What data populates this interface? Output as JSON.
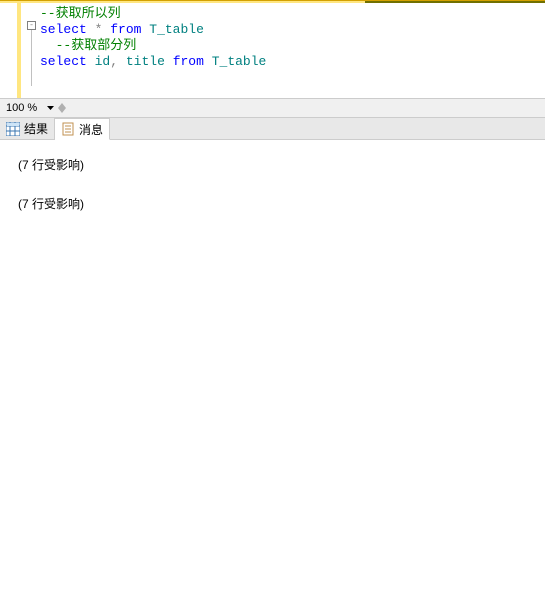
{
  "code": {
    "line1_comment": "--获取所以列",
    "line2": {
      "select": "select",
      "star": "*",
      "from": "from",
      "table": "T_table"
    },
    "line3_comment": "--获取部分列",
    "line4": {
      "select": "select",
      "col1": "id",
      "comma": ",",
      "col2": "title",
      "from": "from",
      "table": "T_table"
    }
  },
  "fold_marker": "-",
  "zoom": {
    "value": "100 %"
  },
  "tabs": {
    "results": "结果",
    "messages": "消息"
  },
  "output": {
    "msg1": "(7 行受影响)",
    "msg2": "(7 行受影响)"
  }
}
